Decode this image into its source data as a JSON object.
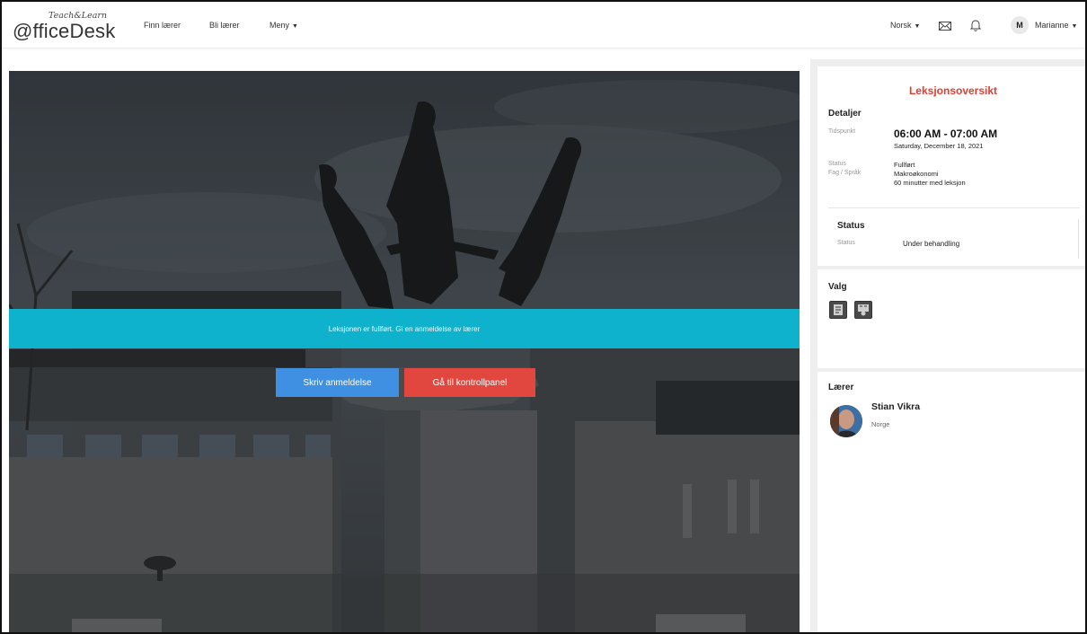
{
  "logo": {
    "main": "@fficeDesk",
    "sup": "Teach&Learn"
  },
  "nav": {
    "finn_laerer": "Finn lærer",
    "bli_laerer": "Bli lærer",
    "meny": "Meny",
    "language": "Norsk",
    "user_initial": "M",
    "user_name": "Marianne"
  },
  "hero": {
    "banner_text": "Leksjonen er fullført. Gi en anmeldelse av lærer",
    "review_button": "Skriv anmeldelse",
    "dashboard_button": "Gå til kontrollpanel"
  },
  "overview": {
    "title": "Leksjonsoversikt",
    "details_heading": "Detaljer",
    "time_label": "Tidspunkt",
    "time_value": "06:00 AM - 07:00 AM",
    "date_value": "Saturday, December 18, 2021",
    "status_label": "Status",
    "status_value": "Fullført",
    "subject_label": "Fag / Språk",
    "subject_value": "Makroøkonomi",
    "duration_value": "60 minutter med leksjon",
    "status_heading": "Status",
    "status2_label": "Status",
    "status2_value": "Under behandling"
  },
  "valg": {
    "heading": "Valg"
  },
  "teacher": {
    "heading": "Lærer",
    "name": "Stian Vikra",
    "country": "Norge"
  },
  "colors": {
    "accent_red": "#e53a2f",
    "banner_cyan": "#0fb2cc",
    "button_blue": "#3f8fe2",
    "button_red": "#e2473f"
  },
  "icons": [
    "mail-icon",
    "bell-icon",
    "chevron-down-icon",
    "document-icon",
    "video-icon"
  ]
}
